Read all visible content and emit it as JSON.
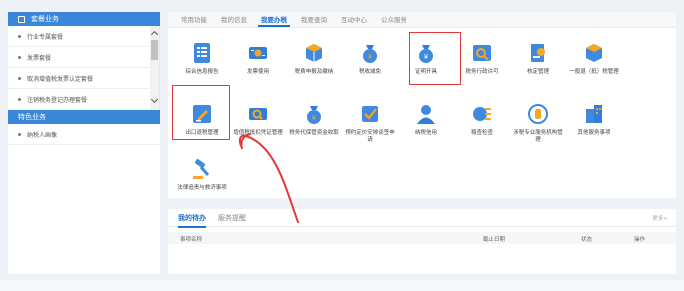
{
  "sidebar": {
    "section1_title": "套餐业务",
    "items": [
      "行业专属套餐",
      "发票套餐",
      "取消增值税发票认定套餐",
      "注销税务登记办理套餐"
    ],
    "section2_title": "特色业务",
    "items2": [
      "纳税人画像"
    ]
  },
  "tabs": [
    "常用功能",
    "我的信息",
    "我要办税",
    "我要查询",
    "互动中心",
    "公众服务"
  ],
  "active_tab": "我要办税",
  "functions": [
    {
      "label": "综合信息报告",
      "icon": "report-icon"
    },
    {
      "label": "发票使用",
      "icon": "invoice-icon"
    },
    {
      "label": "税费申报及缴纳",
      "icon": "declare-pay-icon"
    },
    {
      "label": "税收减免",
      "icon": "tax-relief-icon"
    },
    {
      "label": "证明开具",
      "icon": "certificate-icon"
    },
    {
      "label": "税务行政许可",
      "icon": "administrative-license-icon"
    },
    {
      "label": "核定管理",
      "icon": "verification-icon"
    },
    {
      "label": "一般退（抵）税管理",
      "icon": "tax-refund-icon"
    },
    {
      "label": "出口退税管理",
      "icon": "export-refund-icon"
    },
    {
      "label": "增值税抵扣凭证管理",
      "icon": "vat-deduction-icon"
    },
    {
      "label": "税务代保管资金收取",
      "icon": "custody-fund-icon"
    },
    {
      "label": "预约定价安排谈签申请",
      "icon": "pricing-arrangement-icon"
    },
    {
      "label": "纳税信用",
      "icon": "tax-credit-icon"
    },
    {
      "label": "稽查检查",
      "icon": "inspection-icon"
    },
    {
      "label": "涉税专业服务机构管理",
      "icon": "service-agency-icon"
    },
    {
      "label": "其他服务事项",
      "icon": "other-services-icon"
    },
    {
      "label": "法律追责与救济事项",
      "icon": "legal-remedy-icon"
    }
  ],
  "todo": {
    "tabs": [
      "我的待办",
      "服务提醒"
    ],
    "more": "更多>",
    "columns": [
      "事项名称",
      "截止日期",
      "状态",
      "操作"
    ]
  },
  "colors": {
    "accent": "#1f6fc9",
    "sidebar_head": "#3a86d8",
    "highlight": "#e23a3a"
  }
}
